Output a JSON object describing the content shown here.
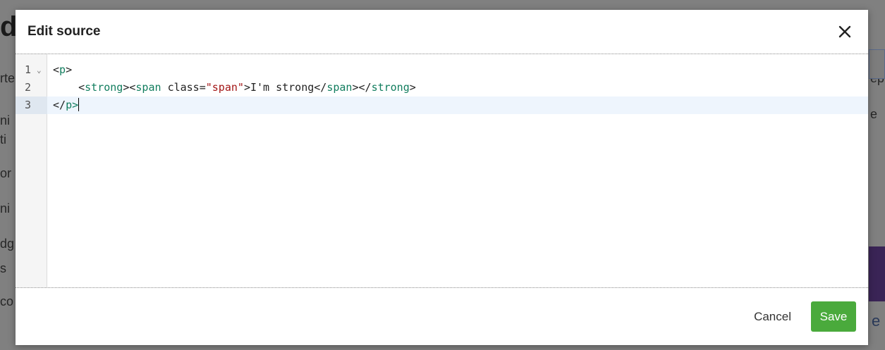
{
  "background": {
    "fragments": [
      "d",
      "rte",
      "ni",
      "ti",
      "or",
      "ni",
      "dg",
      "s",
      "co",
      "ep",
      "e",
      "e"
    ]
  },
  "modal": {
    "title": "Edit source",
    "close_icon": "close-icon",
    "editor": {
      "lines": [
        {
          "number": "1",
          "foldable": true
        },
        {
          "number": "2",
          "foldable": false
        },
        {
          "number": "3",
          "foldable": false
        }
      ],
      "code": {
        "line1": {
          "open": "<",
          "tag": "p",
          "close": ">"
        },
        "line2": {
          "indent": "    ",
          "strong_open": "<strong>",
          "span_open_start": "<span ",
          "attr": "class=",
          "attr_value": "\"span\"",
          "span_open_end": ">",
          "text": "I'm strong",
          "span_close": "</span>",
          "strong_close": "</strong>"
        },
        "line3": {
          "open": "</",
          "tag": "p",
          "close": ">"
        }
      },
      "active_line": "3"
    },
    "footer": {
      "cancel_label": "Cancel",
      "save_label": "Save"
    }
  },
  "colors": {
    "save_button": "#4aaa3c",
    "tag": "#117d5e",
    "attr_value": "#a31515",
    "active_line": "#eef5fd"
  }
}
